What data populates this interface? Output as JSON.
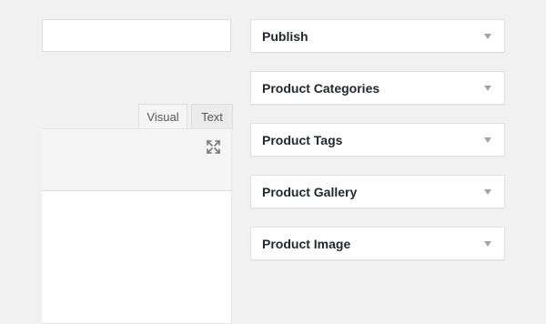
{
  "editor": {
    "tabs": [
      {
        "label": "Visual"
      },
      {
        "label": "Text"
      }
    ],
    "fullscreen_icon": "fullscreen-expand-icon"
  },
  "sidebar": {
    "boxes": [
      {
        "title": "Publish",
        "icon": "caret-down-icon"
      },
      {
        "title": "Product Categories",
        "icon": "caret-down-icon"
      },
      {
        "title": "Product Tags",
        "icon": "caret-down-icon"
      },
      {
        "title": "Product Gallery",
        "icon": "caret-down-icon"
      },
      {
        "title": "Product Image",
        "icon": "caret-down-icon"
      }
    ]
  }
}
